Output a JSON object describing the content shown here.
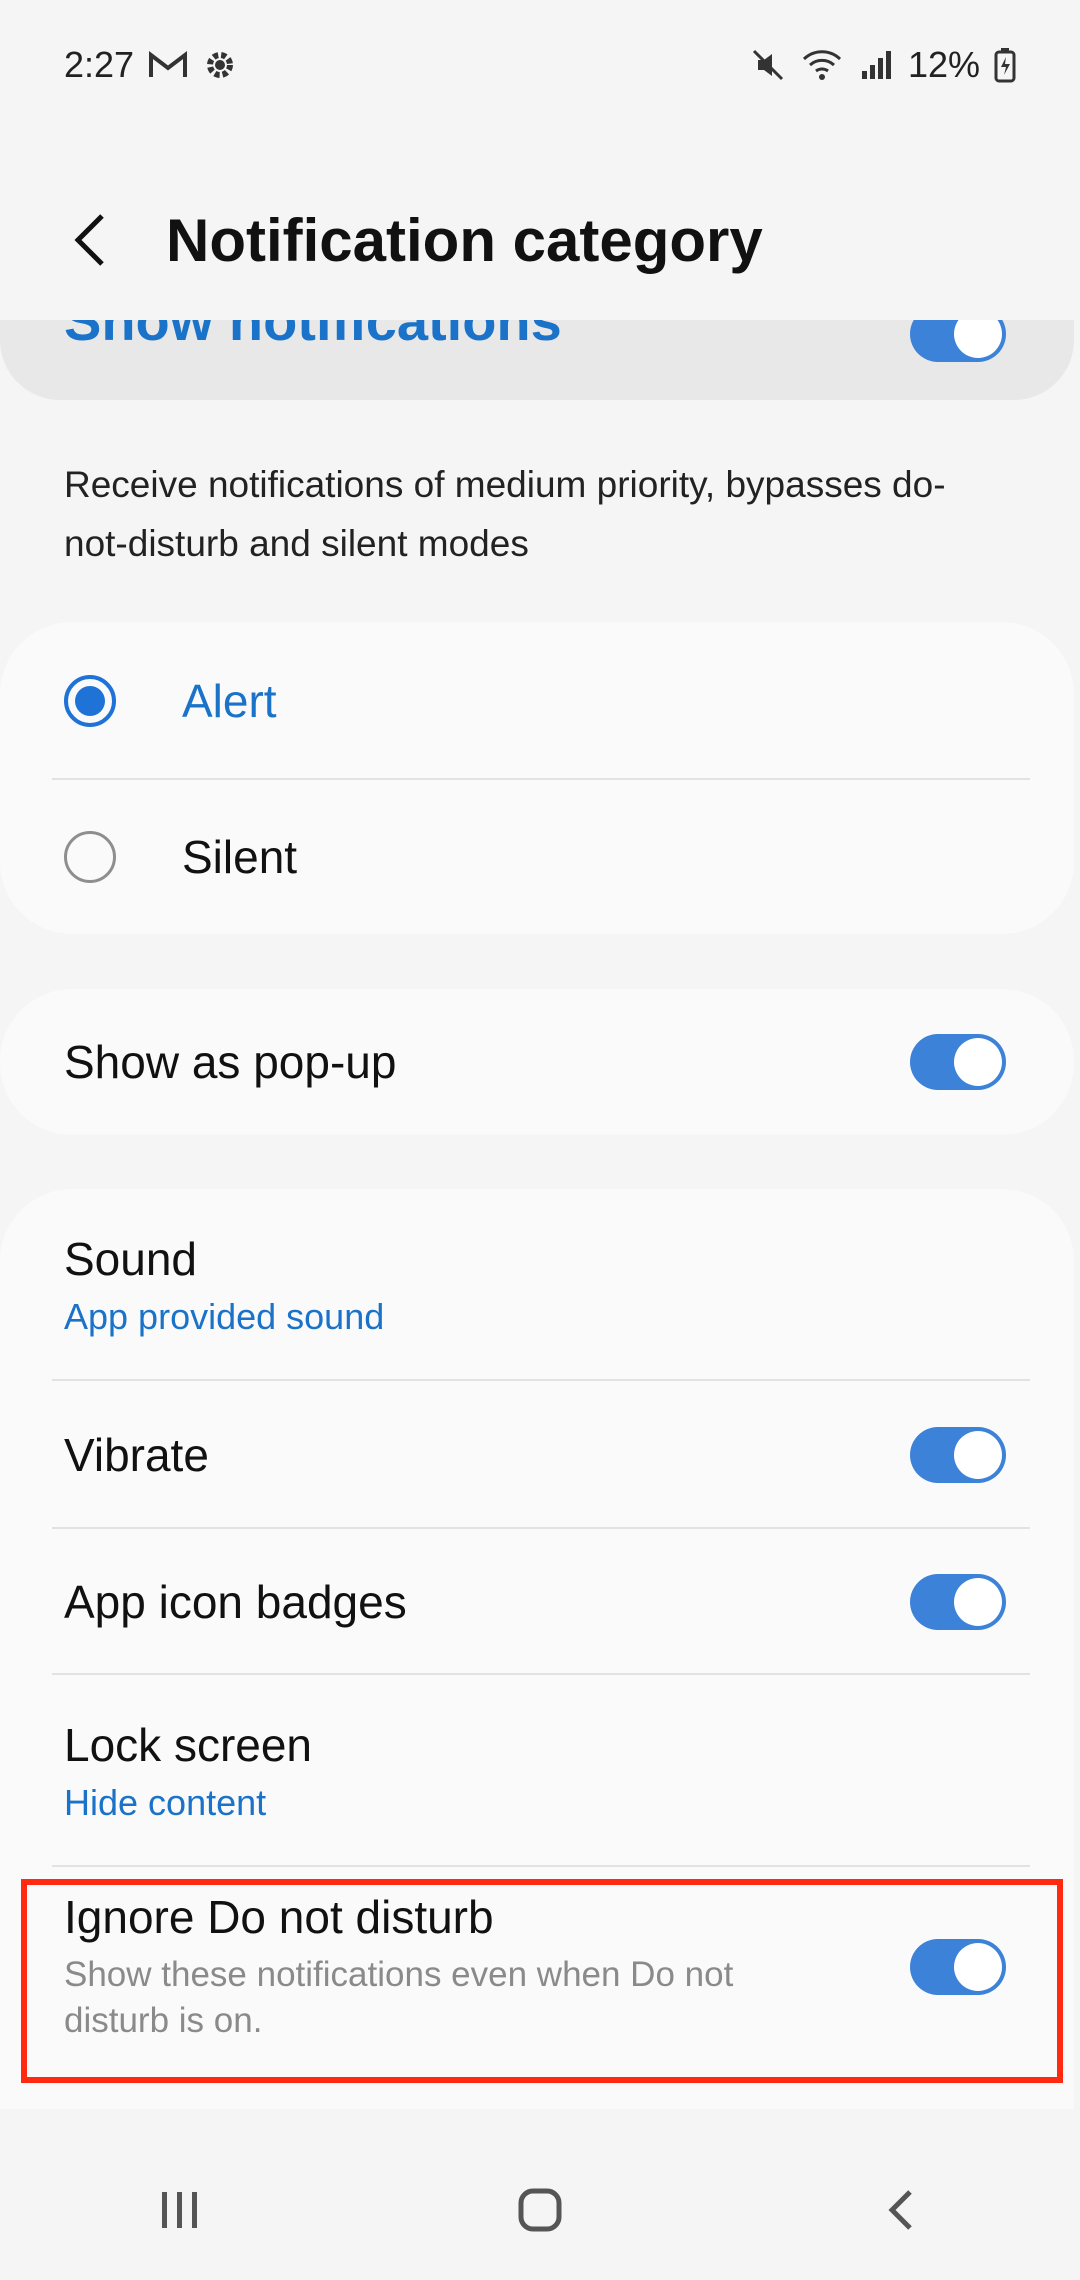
{
  "status_bar": {
    "time": "2:27",
    "battery": "12%",
    "icons": [
      "gmail-icon",
      "settings-gear-icon",
      "mute-icon",
      "wifi-icon",
      "signal-icon",
      "battery-charging-icon"
    ]
  },
  "header": {
    "title": "Notification category"
  },
  "show_notifications": {
    "label": "Show notifications",
    "enabled": true
  },
  "priority_description": "Receive notifications of medium priority, bypasses do-not-disturb and silent modes",
  "alert_options": [
    {
      "label": "Alert",
      "selected": true
    },
    {
      "label": "Silent",
      "selected": false
    }
  ],
  "popup": {
    "label": "Show as pop-up",
    "enabled": true
  },
  "settings": {
    "sound": {
      "label": "Sound",
      "value": "App provided sound"
    },
    "vibrate": {
      "label": "Vibrate",
      "enabled": true
    },
    "badges": {
      "label": "App icon badges",
      "enabled": true
    },
    "lock_screen": {
      "label": "Lock screen",
      "value": "Hide content"
    },
    "ignore_dnd": {
      "label": "Ignore Do not disturb",
      "description": "Show these notifications even when Do not disturb is on.",
      "enabled": true
    }
  },
  "colors": {
    "accent": "#1f73d6",
    "highlight": "#ff2a0f"
  }
}
